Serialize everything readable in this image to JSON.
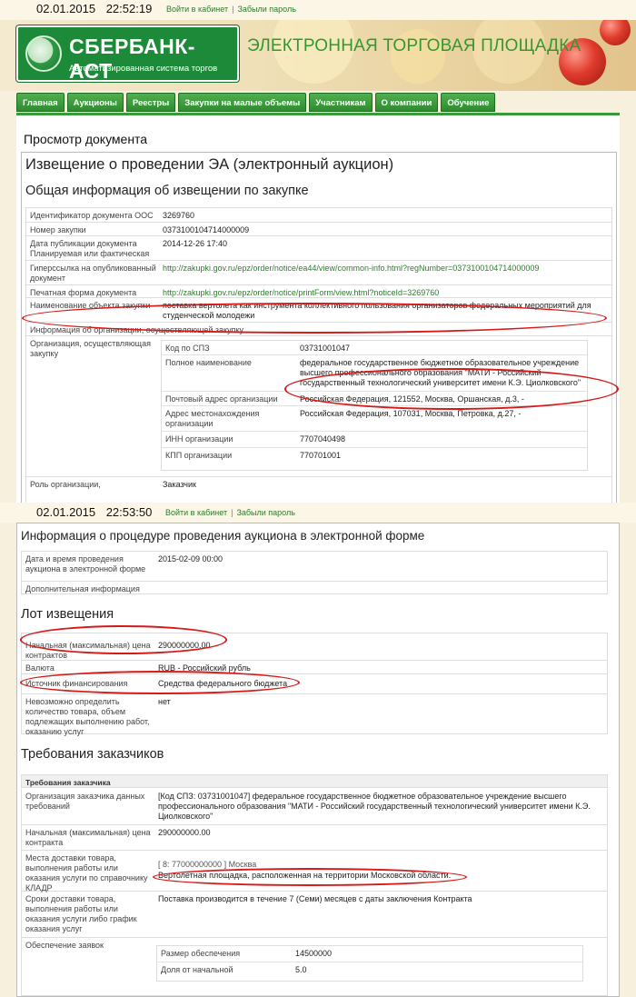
{
  "screenshot1": {
    "timestamp": {
      "date": "02.01.2015",
      "time": "22:52:19"
    },
    "top_links": {
      "login": "Войти в кабинет",
      "separator": "|",
      "forgot": "Забыли пароль"
    },
    "header": {
      "logo_title": "СБЕРБАНК-АСТ",
      "logo_subtitle": "Автоматизированная система торгов",
      "platform_title": "ЭЛЕКТРОННАЯ ТОРГОВАЯ ПЛОЩАДКА"
    },
    "nav": {
      "tabs": [
        "Главная",
        "Аукционы",
        "Реестры",
        "Закупки на малые объемы",
        "Участникам",
        "О компании",
        "Обучение"
      ]
    },
    "page_title": "Просмотр документа",
    "doc_title": "Извещение о проведении ЭА (электронный аукцион)",
    "section_general": "Общая информация об извещении по закупке",
    "general_rows": [
      {
        "label": "Идентификатор документа ООС",
        "value": "3269760"
      },
      {
        "label": "Номер закупки",
        "value": "0373100104714000009"
      },
      {
        "label": "Дата публикации документа Планируемая или фактическая",
        "value": "2014-12-26 17:40"
      },
      {
        "label": "Гиперссылка на опубликованный документ",
        "value": "http://zakupki.gov.ru/epz/order/notice/ea44/view/common-info.html?regNumber=0373100104714000009"
      },
      {
        "label": "Печатная форма документа",
        "value": "http://zakupki.gov.ru/epz/order/notice/printForm/view.html?noticeId=3269760"
      },
      {
        "label": "Наименование объекта закупки",
        "value": "поставка вертолета как инструмента коллективного пользования организаторов федеральных мероприятий для студенческой молодежи"
      },
      {
        "label": "Информация об организации, осуществляющей закупку",
        "value": ""
      },
      {
        "label": "Организация, осуществляющая закупку",
        "value": ""
      },
      {
        "label": "Роль организации,",
        "value": "Заказчик"
      }
    ],
    "org_subrows": [
      {
        "label": "Код по СПЗ",
        "value": "03731001047"
      },
      {
        "label": "Полное наименование",
        "value": "федеральное государственное бюджетное образовательное учреждение высшего профессионального образования \"МАТИ - Российский государственный технологический университет имени К.Э. Циолковского\""
      },
      {
        "label": "Почтовый адрес организации",
        "value": "Российская Федерация, 121552, Москва, Оршанская, д.3, -"
      },
      {
        "label": "Адрес местонахождения организации",
        "value": "Российская Федерация, 107031, Москва, Петровка, д.27, -"
      },
      {
        "label": "ИНН организации",
        "value": "7707040498"
      },
      {
        "label": "КПП организации",
        "value": "770701001"
      }
    ]
  },
  "screenshot2": {
    "timestamp": {
      "date": "02.01.2015",
      "time": "22:53:50"
    },
    "top_links": {
      "login": "Войти в кабинет",
      "separator": "|",
      "forgot": "Забыли пароль"
    },
    "section_procedure": "Информация о процедуре проведения аукциона в электронной форме",
    "procedure_rows": [
      {
        "label": "Дата и время проведения аукциона в электронной форме",
        "value": "2015-02-09 00:00"
      },
      {
        "label": "Дополнительная информация",
        "value": ""
      }
    ],
    "section_lot": "Лот извещения",
    "lot_rows": [
      {
        "label": "Начальная (максимальная) цена контрактов",
        "value": "290000000.00"
      },
      {
        "label": "Валюта",
        "value": "RUB - Российский рубль"
      },
      {
        "label": "Источник финансирования",
        "value": "Средства федерального бюджета"
      },
      {
        "label": "Невозможно определить количество товара, объем подлежащих выполнению работ, оказанию услуг",
        "value": "нет"
      }
    ],
    "section_requirements": "Требования заказчиков",
    "requirements_head": "Требования заказчика",
    "requirements_rows": [
      {
        "label": "Организация заказчика данных требований",
        "value": "[Код СПЗ: 03731001047] федеральное государственное бюджетное образовательное учреждение высшего профессионального образования \"МАТИ - Российский государственный технологический университет имени К.Э. Циолковского\""
      },
      {
        "label": "Начальная (максимальная) цена контракта",
        "value": "290000000.00"
      },
      {
        "label": "Места доставки товара, выполнения работы или оказания услуги по справочнику КЛАДР",
        "value_1": "[ 8: 77000000000 ] Москва",
        "value_2": "Вертолетная площадка, расположенная на территории Московской области."
      },
      {
        "label": "Сроки доставки товара, выполнения работы или оказания услуги либо график оказания услуг",
        "value": "Поставка производится в течение 7 (Семи) месяцев с даты заключения Контракта"
      },
      {
        "label": "Обеспечение заявок",
        "value": ""
      }
    ],
    "security_subrows": [
      {
        "label": "Размер обеспечения",
        "value": "14500000"
      },
      {
        "label": "Доля от начальной",
        "value": "5.0"
      }
    ]
  },
  "colors": {
    "accent_green": "#2e8b2e",
    "highlight_red": "#d61a1a",
    "link_green": "#2f7a2f"
  }
}
